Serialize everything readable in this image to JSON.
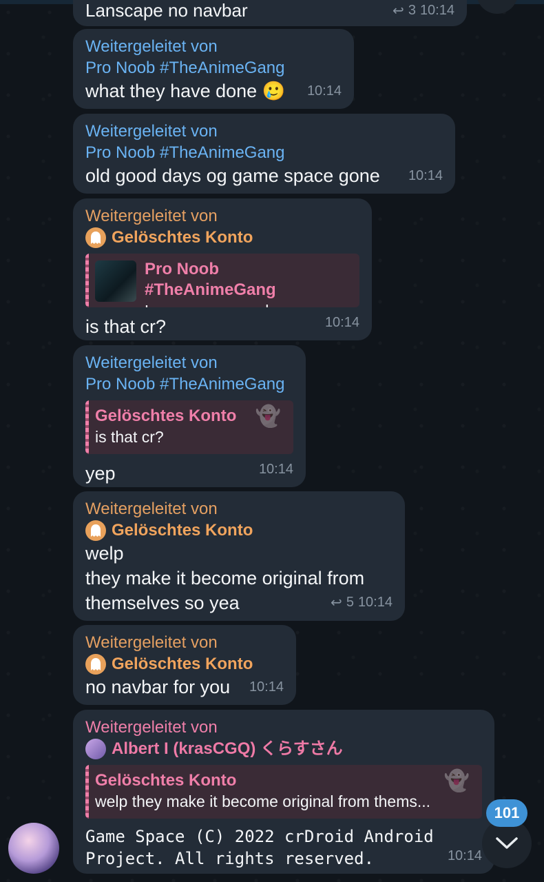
{
  "chat": {
    "forward_prefix": "Weitergeleitet von",
    "messages": [
      {
        "text": "Lanscape no navbar",
        "replies": "3",
        "time": "10:14"
      },
      {
        "from": "Pro Noob #TheAnimeGang",
        "text": "what they have done 🥲",
        "time": "10:14"
      },
      {
        "from": "Pro Noob #TheAnimeGang",
        "text": "old good days og game space gone",
        "time": "10:14"
      },
      {
        "from": "Gelöschtes Konto",
        "quote_title": "Pro Noob #TheAnimeGang",
        "quote_text": "Lanscape no navbar",
        "text": "is that cr?",
        "time": "10:14"
      },
      {
        "from": "Pro Noob #TheAnimeGang",
        "quote_title": "Gelöschtes Konto",
        "quote_text": "is that cr?",
        "text": "yep",
        "time": "10:14"
      },
      {
        "from": "Gelöschtes Konto",
        "text": "welp\nthey make it become original from\nthemselves so yea",
        "replies": "5",
        "time": "10:14"
      },
      {
        "from": "Gelöschtes Konto",
        "text": "no navbar for you",
        "time": "10:14"
      },
      {
        "from": "Albert I (krasCGQ) くらすさん",
        "quote_title": "Gelöschtes Konto",
        "quote_text": "welp they make it become original from thems...",
        "text": "Game Space (C) 2022 crDroid Android\nProject. All rights reserved.",
        "time": "10:14"
      }
    ]
  },
  "scroll": {
    "unread_count": "101"
  }
}
